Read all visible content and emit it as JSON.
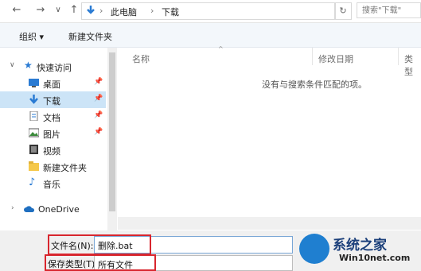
{
  "address_bar": {
    "back": "←",
    "forward": "→",
    "recent": "∨",
    "up": "↑",
    "crumbs": [
      "此电脑",
      "下载"
    ],
    "separator": "›",
    "refresh": "↻",
    "search_placeholder": "搜索\"下载\""
  },
  "toolbar": {
    "organize": "组织 ▾",
    "new_folder": "新建文件夹"
  },
  "nav": {
    "quick_access": "快速访问",
    "items": [
      {
        "label": "桌面",
        "pinned": true
      },
      {
        "label": "下载",
        "pinned": true,
        "selected": true
      },
      {
        "label": "文档",
        "pinned": true
      },
      {
        "label": "图片",
        "pinned": true
      },
      {
        "label": "视频",
        "pinned": false
      },
      {
        "label": "新建文件夹",
        "pinned": false
      },
      {
        "label": "音乐",
        "pinned": false
      }
    ],
    "onedrive": "OneDrive"
  },
  "content": {
    "columns": [
      "名称",
      "修改日期",
      "类型"
    ],
    "empty_message": "没有与搜索条件匹配的项。"
  },
  "save": {
    "filename_label": "文件名(N):",
    "filename_value": "删除.bat",
    "filetype_label": "保存类型(T):",
    "filetype_value": "所有文件"
  },
  "watermark": {
    "brand": "系统之家",
    "url": "Win10net.com"
  },
  "colors": {
    "highlight_box": "#d8262e",
    "selection": "#cce4f7",
    "accent": "#1f7fd0"
  }
}
